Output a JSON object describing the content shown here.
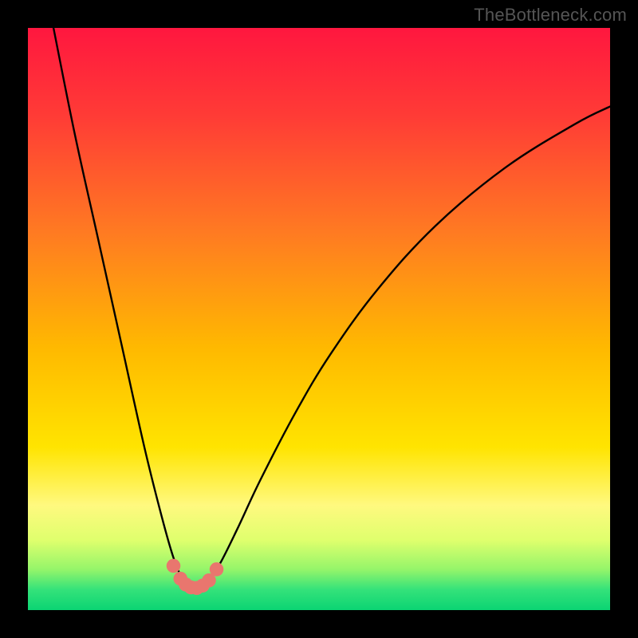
{
  "watermark": "TheBottleneck.com",
  "colors": {
    "frame": "#000000",
    "curve": "#000000",
    "markers_fill": "#e9766e",
    "markers_stroke": "#c24c43",
    "gradient_stops": [
      {
        "offset": 0.0,
        "color": "#ff173f"
      },
      {
        "offset": 0.15,
        "color": "#ff3b36"
      },
      {
        "offset": 0.35,
        "color": "#ff7a22"
      },
      {
        "offset": 0.55,
        "color": "#ffb900"
      },
      {
        "offset": 0.72,
        "color": "#ffe400"
      },
      {
        "offset": 0.82,
        "color": "#fff97f"
      },
      {
        "offset": 0.88,
        "color": "#dfff6d"
      },
      {
        "offset": 0.93,
        "color": "#95f56a"
      },
      {
        "offset": 0.965,
        "color": "#34e27a"
      },
      {
        "offset": 1.0,
        "color": "#0bd473"
      }
    ]
  },
  "chart_data": {
    "type": "line",
    "title": "",
    "xlabel": "",
    "ylabel": "",
    "xlim": [
      0,
      100
    ],
    "ylim": [
      0,
      100
    ],
    "grid": false,
    "legend": false,
    "note": "Bottleneck-style V-curve on a red→green vertical gradient. Lower y = better (green). Minimum of the curve sits near x≈28, y≈4. Pixel-space polyline points are given as [x_percent, y_percent] with (0,0) top-left.",
    "series": [
      {
        "name": "bottleneck-curve",
        "points_percent": [
          [
            4.0,
            -2.0
          ],
          [
            8.0,
            18.0
          ],
          [
            12.0,
            36.0
          ],
          [
            16.0,
            54.0
          ],
          [
            20.0,
            72.0
          ],
          [
            23.0,
            84.0
          ],
          [
            25.0,
            91.0
          ],
          [
            26.5,
            94.5
          ],
          [
            28.0,
            95.8
          ],
          [
            29.5,
            95.9
          ],
          [
            31.0,
            94.8
          ],
          [
            33.0,
            92.0
          ],
          [
            36.0,
            86.0
          ],
          [
            40.0,
            77.5
          ],
          [
            46.0,
            66.0
          ],
          [
            52.0,
            56.0
          ],
          [
            60.0,
            45.0
          ],
          [
            70.0,
            34.0
          ],
          [
            82.0,
            24.0
          ],
          [
            94.0,
            16.5
          ],
          [
            100.0,
            13.5
          ]
        ]
      }
    ],
    "markers": {
      "name": "optimum-band",
      "shape": "circle",
      "radius_percent": 1.2,
      "points_percent": [
        [
          25.0,
          92.4
        ],
        [
          26.2,
          94.6
        ],
        [
          27.1,
          95.6
        ],
        [
          28.0,
          96.1
        ],
        [
          29.0,
          96.2
        ],
        [
          30.0,
          95.8
        ],
        [
          31.1,
          94.9
        ],
        [
          32.4,
          93.0
        ]
      ]
    }
  }
}
